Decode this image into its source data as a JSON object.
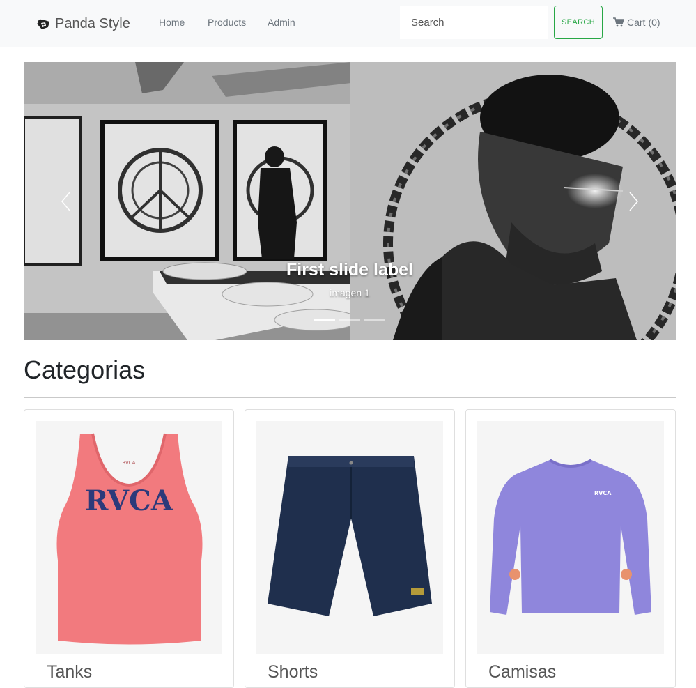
{
  "navbar": {
    "brand": "Panda Style",
    "links": [
      "Home",
      "Products",
      "Admin"
    ],
    "search_placeholder": "Search",
    "search_button": "SEARCH",
    "cart_label": "Cart",
    "cart_count": "(0)"
  },
  "carousel": {
    "caption_title": "First slide label",
    "caption_text": "imagen 1",
    "slide_count": 3,
    "active_index": 0
  },
  "categories": {
    "heading": "Categorias",
    "items": [
      {
        "name": "Tanks",
        "image": "pink-rvca-tank-top"
      },
      {
        "name": "Shorts",
        "image": "navy-chino-shorts"
      },
      {
        "name": "Camisas",
        "image": "purple-long-sleeve-shirt"
      }
    ]
  },
  "colors": {
    "search_button_accent": "#28a745",
    "navbar_bg": "#f8f9fa"
  }
}
